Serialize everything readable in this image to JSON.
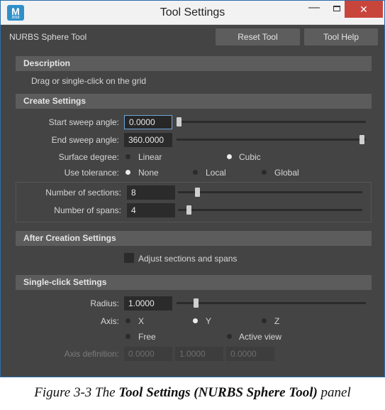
{
  "window": {
    "logo_letter": "M",
    "title": "Tool Settings",
    "minimize_glyph": "—",
    "close_glyph": "✕"
  },
  "toolbar": {
    "tool_name": "NURBS Sphere Tool",
    "reset_label": "Reset Tool",
    "help_label": "Tool Help"
  },
  "description": {
    "header": "Description",
    "text": "Drag or single-click on the grid"
  },
  "create_settings": {
    "header": "Create Settings",
    "start_sweep": {
      "label": "Start sweep angle:",
      "value": "0.0000",
      "slider_fraction": 0.0
    },
    "end_sweep": {
      "label": "End sweep angle:",
      "value": "360.0000",
      "slider_fraction": 1.0
    },
    "surface_degree": {
      "label": "Surface degree:",
      "options": [
        "Linear",
        "Cubic"
      ],
      "selected": "Cubic"
    },
    "use_tolerance": {
      "label": "Use tolerance:",
      "options": [
        "None",
        "Local",
        "Global"
      ],
      "selected": "None"
    },
    "sections": {
      "label": "Number of sections:",
      "value": "8"
    },
    "spans": {
      "label": "Number of spans:",
      "value": "4"
    }
  },
  "after_creation": {
    "header": "After Creation Settings",
    "adjust_label": "Adjust sections and spans",
    "adjust_checked": false
  },
  "single_click": {
    "header": "Single-click Settings",
    "radius": {
      "label": "Radius:",
      "value": "1.0000"
    },
    "axis": {
      "label": "Axis:",
      "options": [
        "X",
        "Y",
        "Z",
        "Free",
        "Active view"
      ],
      "selected": "Y"
    },
    "axis_definition": {
      "label": "Axis definition:",
      "values": [
        "0.0000",
        "1.0000",
        "0.0000"
      ]
    }
  },
  "caption": {
    "prefix": "Figure 3-3  The ",
    "bold": "Tool Settings (NURBS Sphere Tool)",
    "suffix": " panel"
  },
  "colors": {
    "panel_bg": "#444444",
    "section_header_bg": "#5c5c5c",
    "field_bg": "#2b2b2b",
    "active_field_border": "#6ea6d8",
    "logo_blue": "#2f8fc9",
    "close_red": "#c8453c"
  }
}
